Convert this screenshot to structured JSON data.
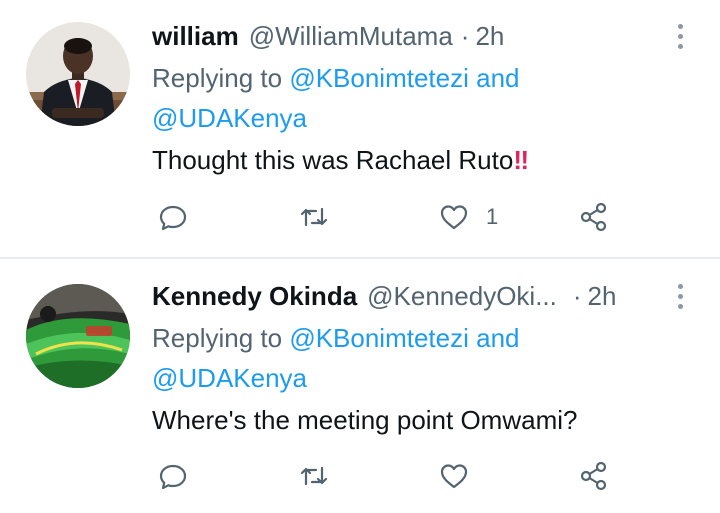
{
  "tweets": [
    {
      "name": "william",
      "handle": "@WilliamMutama",
      "separator": "·",
      "time": "2h",
      "replying_prefix": "Replying to",
      "mention_1": "@KBonimtetezi",
      "conjunction": "and",
      "mention_2": "@UDAKenya",
      "text": "Thought this was Rachael Ruto",
      "emoji": "‼",
      "like_count": "1"
    },
    {
      "name": "Kennedy Okinda",
      "handle": "@KennedyOki...",
      "separator": "·",
      "time": "2h",
      "replying_prefix": "Replying to",
      "mention_1": "@KBonimtetezi",
      "conjunction": "and",
      "mention_2": "@UDAKenya",
      "text": "Where's the meeting point Omwami?",
      "like_count": ""
    }
  ],
  "icons": {
    "reply": "reply-icon",
    "retweet": "retweet-icon",
    "like": "heart-icon",
    "share": "share-icon",
    "more": "more-options-icon"
  },
  "colors": {
    "link": "#1d9bf0",
    "secondary": "#536471",
    "emoji": "#e0245e"
  }
}
